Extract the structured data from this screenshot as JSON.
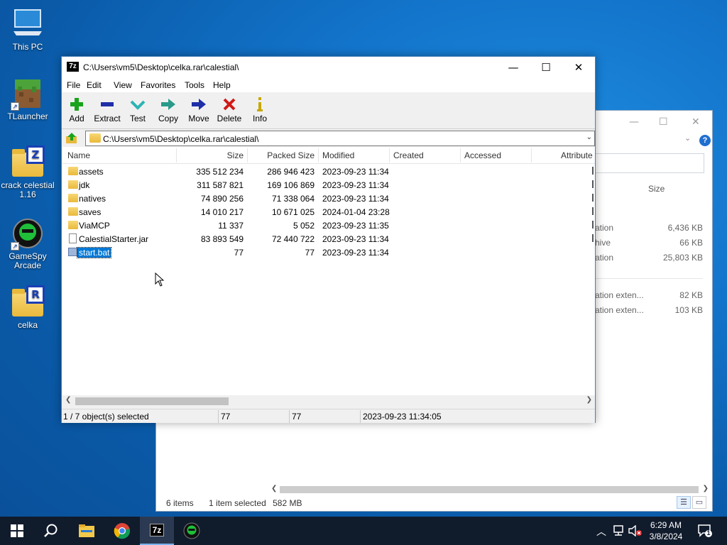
{
  "desktop": {
    "icons": [
      {
        "label": "This PC"
      },
      {
        "label": "TLauncher"
      },
      {
        "label": "crack celestial 1.16"
      },
      {
        "label": "GameSpy Arcade"
      },
      {
        "label": "celka"
      }
    ]
  },
  "explorer_bg": {
    "column_size": "Size",
    "rows": [
      {
        "type": "ation",
        "size": "6,436 KB"
      },
      {
        "type": "hive",
        "size": "66 KB"
      },
      {
        "type": "ation",
        "size": "25,803 KB"
      },
      {
        "type": "ation exten...",
        "size": "82 KB"
      },
      {
        "type": "ation exten...",
        "size": "103 KB"
      }
    ],
    "status": {
      "items": "6 items",
      "selected": "1 item selected",
      "size": "582 MB"
    }
  },
  "zip": {
    "title": "C:\\Users\\vm5\\Desktop\\celka.rar\\calestial\\",
    "app_icon": "7z",
    "menu": [
      "File",
      "Edit",
      "View",
      "Favorites",
      "Tools",
      "Help"
    ],
    "toolbar": [
      {
        "label": "Add",
        "icon": "plus-icon",
        "color": "#1aa31a"
      },
      {
        "label": "Extract",
        "icon": "minus-icon",
        "color": "#1f2fa8"
      },
      {
        "label": "Test",
        "icon": "check-icon",
        "color": "#2db3b3"
      },
      {
        "label": "Copy",
        "icon": "arrow-right-icon",
        "color": "#2a9a8a"
      },
      {
        "label": "Move",
        "icon": "arrow-right-icon",
        "color": "#1f2fa8"
      },
      {
        "label": "Delete",
        "icon": "x-icon",
        "color": "#d01818"
      },
      {
        "label": "Info",
        "icon": "info-icon",
        "color": "#c8a800"
      }
    ],
    "address": "C:\\Users\\vm5\\Desktop\\celka.rar\\calestial\\",
    "columns": [
      "Name",
      "Size",
      "Packed Size",
      "Modified",
      "Created",
      "Accessed",
      "Attribute"
    ],
    "rows": [
      {
        "name": "assets",
        "kind": "folder",
        "size": "335 512 234",
        "packed": "286 946 423",
        "modified": "2023-09-23 11:34"
      },
      {
        "name": "jdk",
        "kind": "folder",
        "size": "311 587 821",
        "packed": "169 106 869",
        "modified": "2023-09-23 11:34"
      },
      {
        "name": "natives",
        "kind": "folder",
        "size": "74 890 256",
        "packed": "71 338 064",
        "modified": "2023-09-23 11:34"
      },
      {
        "name": "saves",
        "kind": "folder",
        "size": "14 010 217",
        "packed": "10 671 025",
        "modified": "2024-01-04 23:28"
      },
      {
        "name": "ViaMCP",
        "kind": "folder",
        "size": "11 337",
        "packed": "5 052",
        "modified": "2023-09-23 11:35"
      },
      {
        "name": "CalestialStarter.jar",
        "kind": "file",
        "size": "83 893 549",
        "packed": "72 440 722",
        "modified": "2023-09-23 11:34"
      },
      {
        "name": "start.bat",
        "kind": "bat",
        "size": "77",
        "packed": "77",
        "modified": "2023-09-23 11:34",
        "selected": true
      }
    ],
    "status": {
      "selection": "1 / 7 object(s) selected",
      "size": "77",
      "packed": "77",
      "modified": "2023-09-23 11:34:05"
    }
  },
  "taskbar": {
    "clock_time": "6:29 AM",
    "clock_date": "3/8/2024",
    "notification_count": "1"
  }
}
